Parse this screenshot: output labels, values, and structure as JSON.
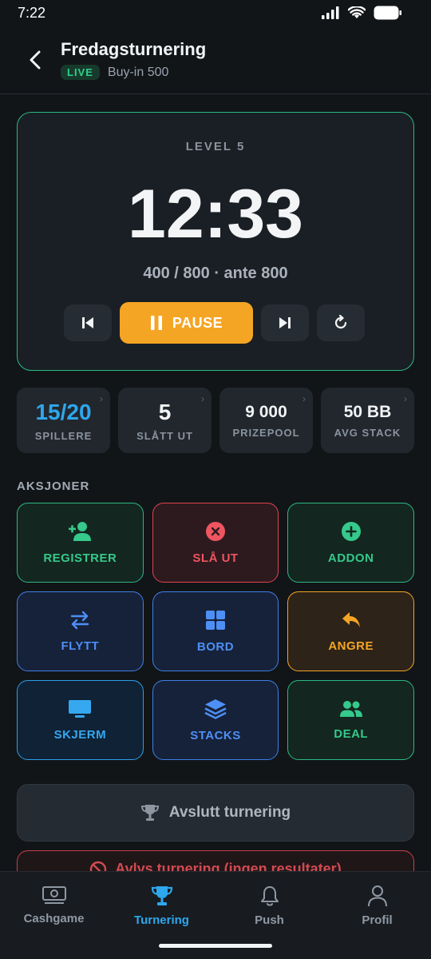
{
  "status_bar": {
    "time": "7:22"
  },
  "header": {
    "title": "Fredagsturnering",
    "live_badge": "LIVE",
    "buyin": "Buy-in 500"
  },
  "timer": {
    "level": "LEVEL 5",
    "clock": "12:33",
    "blinds": "400 / 800 · ante 800",
    "pause_label": "PAUSE"
  },
  "stats": [
    {
      "value": "15/20",
      "label": "SPILLERE"
    },
    {
      "value": "5",
      "label": "SLÅTT UT"
    },
    {
      "value": "9 000",
      "label": "PRIZEPOOL"
    },
    {
      "value": "50 BB",
      "label": "AVG STACK"
    }
  ],
  "actions": {
    "title": "AKSJONER",
    "items": [
      {
        "label": "REGISTRER",
        "icon": "add-user-icon",
        "color": "#35c98c"
      },
      {
        "label": "SLÅ UT",
        "icon": "close-circle-icon",
        "color": "#ef5560"
      },
      {
        "label": "ADDON",
        "icon": "plus-circle-icon",
        "color": "#35c98c"
      },
      {
        "label": "FLYTT",
        "icon": "swap-icon",
        "color": "#4d8ff5"
      },
      {
        "label": "BORD",
        "icon": "grid-icon",
        "color": "#4d8ff5"
      },
      {
        "label": "ANGRE",
        "icon": "undo-icon",
        "color": "#f5a524"
      },
      {
        "label": "SKJERM",
        "icon": "monitor-icon",
        "color": "#35a8f0"
      },
      {
        "label": "STACKS",
        "icon": "layers-icon",
        "color": "#4d8ff5"
      },
      {
        "label": "DEAL",
        "icon": "group-icon",
        "color": "#35c98c"
      }
    ]
  },
  "end_button": "Avslutt turnering",
  "cancel_button": "Avlys turnering (ingen resultater)",
  "nav": [
    {
      "label": "Cashgame",
      "icon": "cash-icon"
    },
    {
      "label": "Turnering",
      "icon": "trophy-icon"
    },
    {
      "label": "Push",
      "icon": "bell-icon"
    },
    {
      "label": "Profil",
      "icon": "user-icon"
    }
  ]
}
